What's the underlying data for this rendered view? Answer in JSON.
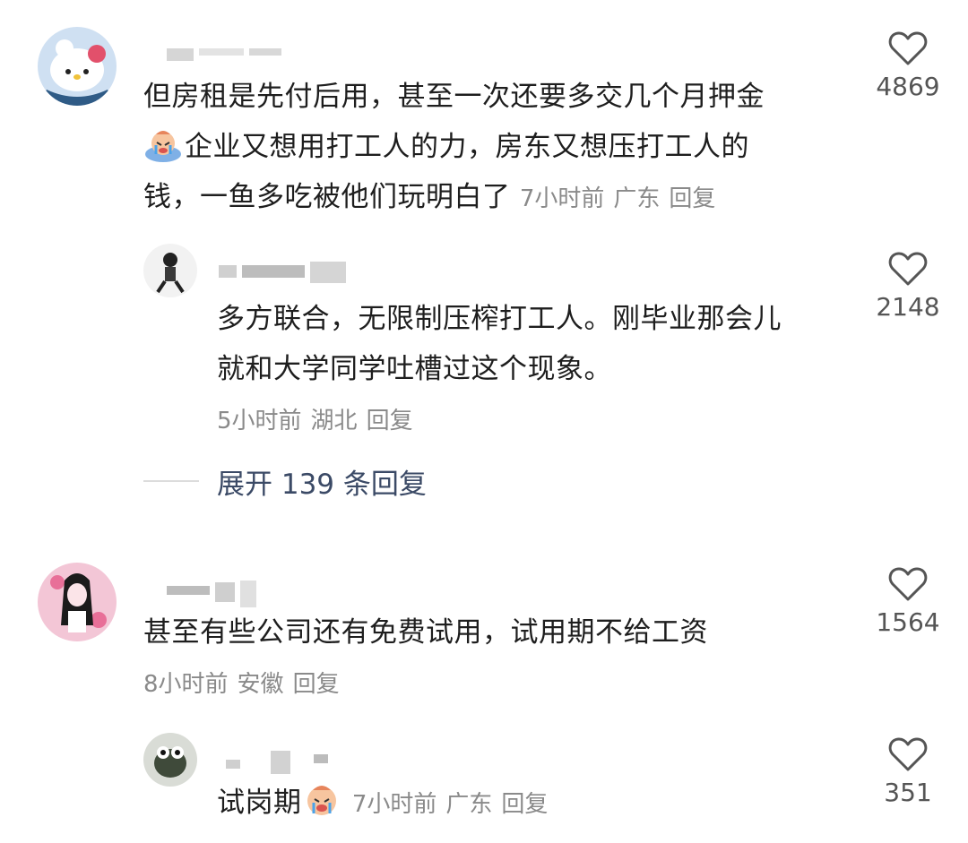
{
  "comments": [
    {
      "text_lines": [
        "但房租是先付后用，甚至一次还要多交几个月押金",
        "企业又想用打工人的力，房东又想压打工人的",
        "钱，一鱼多吃被他们玩明白了"
      ],
      "time": "7小时前",
      "location": "广东",
      "reply": "回复",
      "likes": "4869",
      "emoji_name": "crying-emoji"
    },
    {
      "text_lines": [
        "多方联合，无限制压榨打工人。刚毕业那会儿",
        "就和大学同学吐槽过这个现象。"
      ],
      "time": "5小时前",
      "location": "湖北",
      "reply": "回复",
      "likes": "2148"
    },
    {
      "text_lines": [
        "甚至有些公司还有免费试用，试用期不给工资"
      ],
      "time": "8小时前",
      "location": "安徽",
      "reply": "回复",
      "likes": "1564"
    },
    {
      "text_lines": [
        "试岗期"
      ],
      "time": "7小时前",
      "location": "广东",
      "reply": "回复",
      "likes": "351",
      "emoji_name": "crying-emoji"
    }
  ],
  "expand_replies": "展开 139 条回复",
  "colors": {
    "text": "#1e1e1e",
    "meta": "#8a8a8a",
    "expand": "#3b4a66",
    "heart": "#555555"
  }
}
